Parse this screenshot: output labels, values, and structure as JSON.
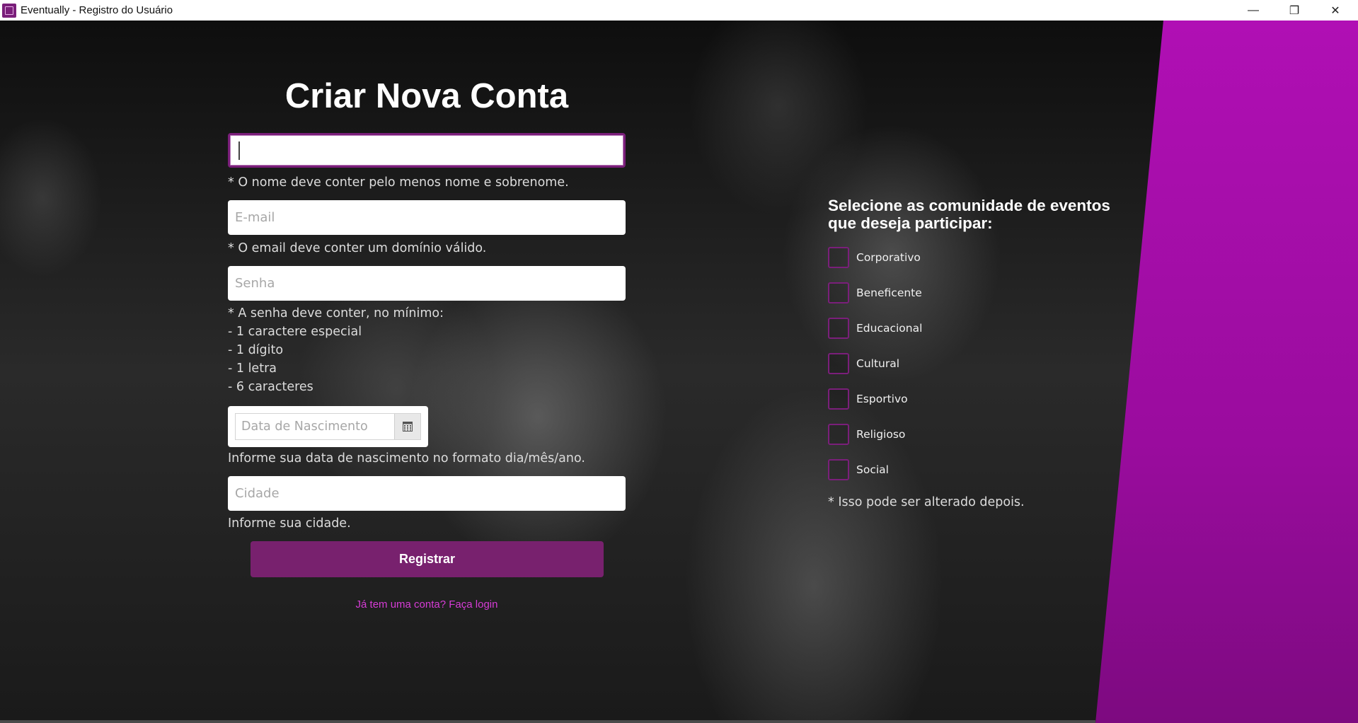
{
  "window": {
    "title": "Eventually - Registro do Usuário",
    "controls": {
      "minimize": "—",
      "restore": "❐",
      "close": "✕"
    }
  },
  "colors": {
    "accent": "#78216e",
    "band": "#b00fb4",
    "link": "#d63cd6"
  },
  "form": {
    "title": "Criar Nova Conta",
    "name_value": "",
    "name_hint": "* O nome deve conter pelo menos nome e sobrenome.",
    "email_placeholder": "E-mail",
    "email_hint": "* O email deve conter um domínio válido.",
    "password_placeholder": "Senha",
    "password_hints": [
      "* A senha deve conter, no mínimo:",
      "- 1 caractere especial",
      "- 1 dígito",
      "- 1 letra",
      "- 6 caracteres"
    ],
    "birthdate_placeholder": "Data de Nascimento",
    "birthdate_hint": "Informe sua data de nascimento no formato dia/mês/ano.",
    "city_placeholder": "Cidade",
    "city_hint": "Informe sua cidade.",
    "register_label": "Registrar",
    "login_link": "Já tem uma conta? Faça login"
  },
  "communities": {
    "title": "Selecione as comunidade de eventos que deseja participar:",
    "options": [
      {
        "label": "Corporativo",
        "checked": false
      },
      {
        "label": "Beneficente",
        "checked": false
      },
      {
        "label": "Educacional",
        "checked": false
      },
      {
        "label": "Cultural",
        "checked": false
      },
      {
        "label": "Esportivo",
        "checked": false
      },
      {
        "label": "Religioso",
        "checked": false
      },
      {
        "label": "Social",
        "checked": false
      }
    ],
    "note": "* Isso pode ser alterado depois."
  }
}
